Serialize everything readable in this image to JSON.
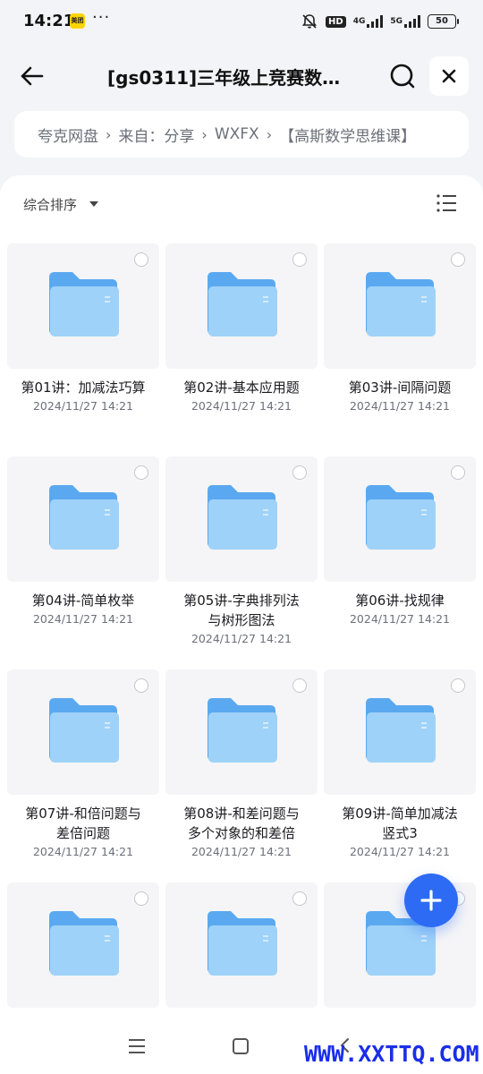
{
  "status": {
    "time": "14:21",
    "app_badge": "美团",
    "more": "···",
    "network1": "4G",
    "network2": "5G",
    "hd": "HD",
    "battery": "50"
  },
  "header": {
    "title": "[gs0311]三年级上竞赛数…",
    "back_icon": "arrow-left-icon",
    "search_icon": "search-icon",
    "close_icon": "close-icon"
  },
  "breadcrumb": {
    "items": [
      "夸克网盘",
      "来自：分享",
      "WXFX",
      "【高斯数学思维课】"
    ]
  },
  "sort": {
    "label": "综合排序",
    "view_icon": "list-view-icon"
  },
  "files": [
    {
      "name_lines": [
        "第01讲：加减法巧算"
      ],
      "date": "2024/11/27 14:21"
    },
    {
      "name_lines": [
        "第02讲-基本应用题"
      ],
      "date": "2024/11/27 14:21"
    },
    {
      "name_lines": [
        "第03讲-间隔问题"
      ],
      "date": "2024/11/27 14:21"
    },
    {
      "name_lines": [
        "第04讲-简单枚举"
      ],
      "date": "2024/11/27 14:21"
    },
    {
      "name_lines": [
        "第05讲-字典排列法",
        "与树形图法"
      ],
      "date": "2024/11/27 14:21"
    },
    {
      "name_lines": [
        "第06讲-找规律"
      ],
      "date": "2024/11/27 14:21"
    },
    {
      "name_lines": [
        "第07讲-和倍问题与",
        "差倍问题"
      ],
      "date": "2024/11/27 14:21"
    },
    {
      "name_lines": [
        "第08讲-和差问题与",
        "多个对象的和差倍"
      ],
      "date": "2024/11/27 14:21"
    },
    {
      "name_lines": [
        "第09讲-简单加减法",
        "竖式3"
      ],
      "date": "2024/11/27 14:21"
    },
    {
      "name_lines": [],
      "date": ""
    },
    {
      "name_lines": [],
      "date": ""
    },
    {
      "name_lines": [],
      "date": ""
    }
  ],
  "fab_icon": "plus-icon",
  "watermark": "WWW.XXTTQ.COM",
  "colors": {
    "accent": "#2d6bf4",
    "folder_back": "#5aa9f0",
    "folder_front": "#9fd2f8",
    "watermark": "#1a2ee8"
  }
}
